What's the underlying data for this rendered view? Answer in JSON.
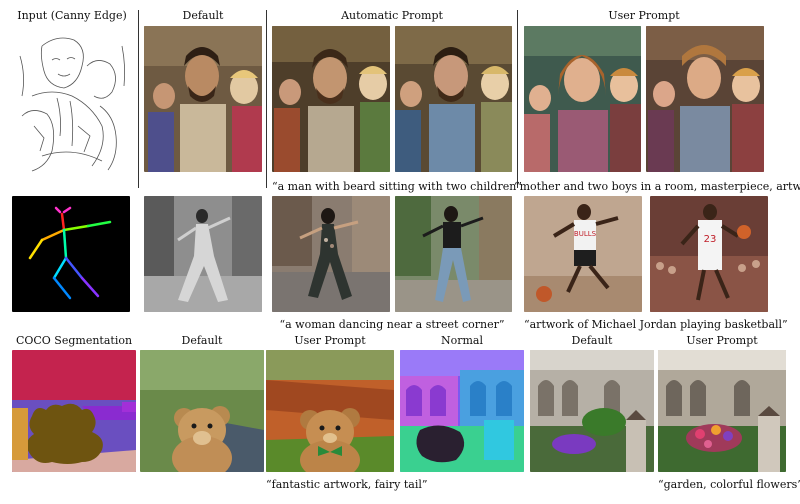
{
  "row1": {
    "labels": {
      "input": "Input (Canny Edge)",
      "default": "Default",
      "automatic": "Automatic Prompt",
      "user": "User Prompt"
    },
    "captions": {
      "automatic": "“a man with beard sitting with two children”",
      "user": "“mother and two boys in a room, masterpiece, artwork”"
    }
  },
  "row2": {
    "captions": {
      "automatic": "“a woman dancing near a street corner”",
      "user": "“artwork of Michael Jordan playing basketball”"
    },
    "jersey_number": "23",
    "jersey_text": "BULLS"
  },
  "row3": {
    "labels": {
      "coco": "COCO Segmentation",
      "default_a": "Default",
      "user_a": "User Prompt",
      "normal": "Normal",
      "default_b": "Default",
      "user_b": "User Prompt"
    },
    "captions": {
      "teddy": "“fantastic artwork, fairy tail”",
      "garden": "“garden, colorful flowers”"
    }
  }
}
